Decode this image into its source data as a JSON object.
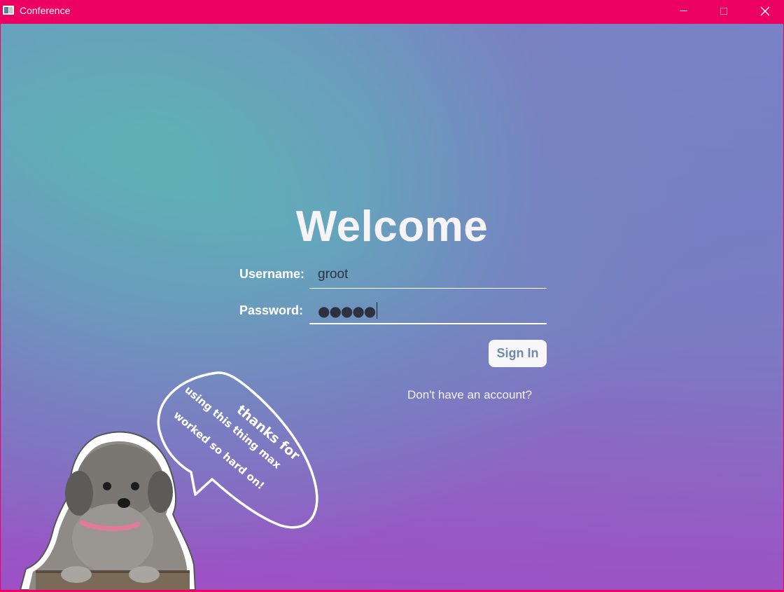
{
  "window": {
    "title": "Conference",
    "controls": [
      "minimize-icon",
      "maximize-icon",
      "close-icon"
    ]
  },
  "colors": {
    "titlebar": "#ec0062",
    "gradient_teal": "#5db4b3",
    "gradient_purple": "#9c55c4",
    "button_text": "#6f8aaa"
  },
  "login": {
    "heading": "Welcome",
    "username_label": "Username:",
    "username_value": "groot",
    "password_label": "Password:",
    "password_value": "●●●●●",
    "signin_label": "Sign In",
    "signup_link": "Don't have an account?"
  },
  "sticker": {
    "bubble_lines": [
      "thanks for",
      "using this thing max",
      "worked so hard on!"
    ]
  }
}
